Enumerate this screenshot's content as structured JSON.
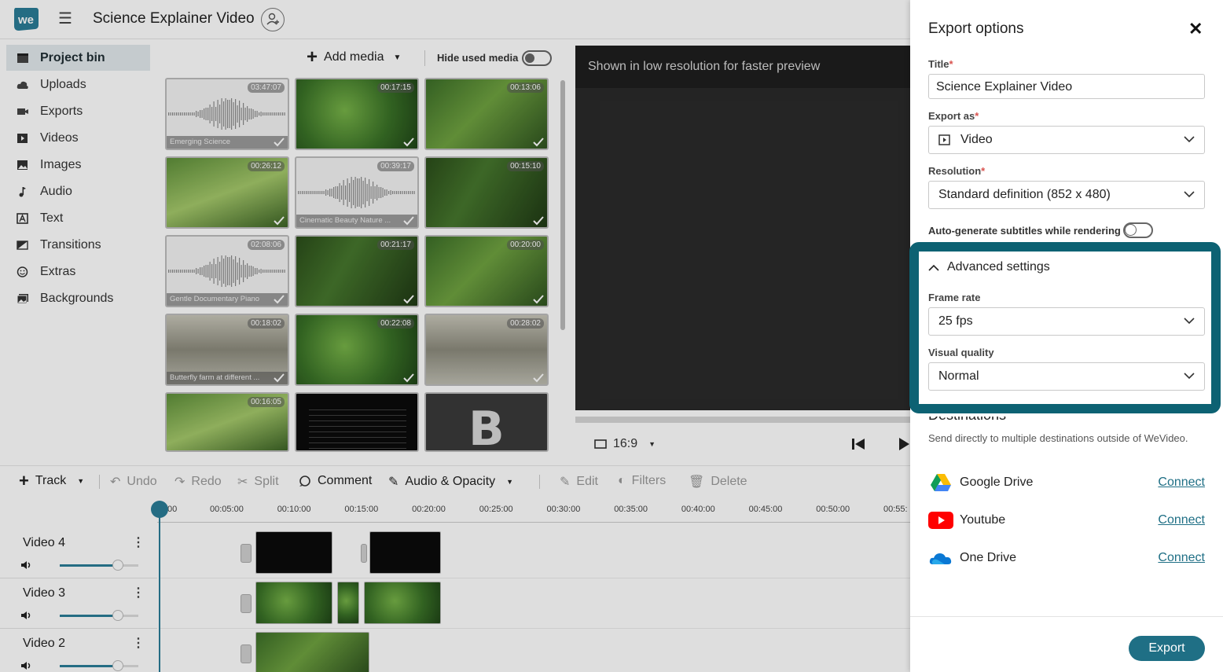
{
  "app": {
    "project_title": "Science Explainer Video",
    "colors": {
      "accent": "#1f6f85",
      "highlight_frame": "#0d6273",
      "playhead": "#2a7c97",
      "brand": "#2a7c97"
    }
  },
  "sidebar": {
    "items": [
      {
        "label": "Project bin",
        "icon": "project-bin-icon",
        "active": true
      },
      {
        "label": "Uploads",
        "icon": "cloud-upload-icon"
      },
      {
        "label": "Exports",
        "icon": "video-camera-icon"
      },
      {
        "label": "Videos",
        "icon": "play-box-icon"
      },
      {
        "label": "Images",
        "icon": "image-icon"
      },
      {
        "label": "Audio",
        "icon": "music-note-icon"
      },
      {
        "label": "Text",
        "icon": "text-icon"
      },
      {
        "label": "Transitions",
        "icon": "transition-icon"
      },
      {
        "label": "Extras",
        "icon": "smiley-icon"
      },
      {
        "label": "Backgrounds",
        "icon": "background-icon"
      }
    ]
  },
  "media": {
    "add_media_label": "Add media",
    "hide_used_label": "Hide used media",
    "items": [
      {
        "duration": "03:47:07",
        "caption": "Emerging Science",
        "type": "audio"
      },
      {
        "duration": "00:17:15",
        "caption": "",
        "type": "video"
      },
      {
        "duration": "00:13:06",
        "caption": "",
        "type": "video"
      },
      {
        "duration": "00:26:12",
        "caption": "",
        "type": "video"
      },
      {
        "duration": "00:39:17",
        "caption": "Cinematic Beauty Nature ...",
        "type": "audio"
      },
      {
        "duration": "00:15:10",
        "caption": "",
        "type": "video"
      },
      {
        "duration": "02:08:06",
        "caption": "Gentle Documentary Piano",
        "type": "audio"
      },
      {
        "duration": "00:21:17",
        "caption": "",
        "type": "video"
      },
      {
        "duration": "00:20:00",
        "caption": "",
        "type": "video"
      },
      {
        "duration": "00:18:02",
        "caption": "Butterfly farm at different ...",
        "type": "video"
      },
      {
        "duration": "00:22:08",
        "caption": "",
        "type": "video"
      },
      {
        "duration": "00:28:02",
        "caption": "",
        "type": "video"
      },
      {
        "duration": "00:16:05",
        "caption": "",
        "type": "video"
      },
      {
        "duration": "",
        "caption": "",
        "type": "text"
      },
      {
        "duration": "",
        "caption": "",
        "type": "image"
      }
    ]
  },
  "preview": {
    "note": "Shown in low resolution for faster preview",
    "aspect_ratio": "16:9"
  },
  "timeline": {
    "toolbar": {
      "track": "Track",
      "undo": "Undo",
      "redo": "Redo",
      "split": "Split",
      "comment": "Comment",
      "audio_opacity": "Audio & Opacity",
      "edit": "Edit",
      "filters": "Filters",
      "delete": "Delete"
    },
    "ruler": [
      "00",
      "00:05:00",
      "00:10:00",
      "00:15:00",
      "00:20:00",
      "00:25:00",
      "00:30:00",
      "00:35:00",
      "00:40:00",
      "00:45:00",
      "00:50:00",
      "00:55:"
    ],
    "tracks": [
      {
        "name": "Video 4"
      },
      {
        "name": "Video 3"
      },
      {
        "name": "Video 2"
      }
    ]
  },
  "export_panel": {
    "title": "Export options",
    "title_label": "Title",
    "title_value": "Science Explainer Video",
    "export_as_label": "Export as",
    "export_as_value": "Video",
    "resolution_label": "Resolution",
    "resolution_value": "Standard definition (852 x 480)",
    "subtitles_label": "Auto-generate subtitles while rendering",
    "advanced_label": "Advanced settings",
    "frame_rate_label": "Frame rate",
    "frame_rate_value": "25 fps",
    "visual_quality_label": "Visual quality",
    "visual_quality_value": "Normal",
    "destinations_title": "Destinations",
    "destinations_sub": "Send directly to multiple destinations outside of WeVideo.",
    "destinations": [
      {
        "name": "Google Drive",
        "action": "Connect",
        "icon": "google-drive-icon"
      },
      {
        "name": "Youtube",
        "action": "Connect",
        "icon": "youtube-icon"
      },
      {
        "name": "One Drive",
        "action": "Connect",
        "icon": "onedrive-icon"
      }
    ],
    "export_button": "Export"
  }
}
